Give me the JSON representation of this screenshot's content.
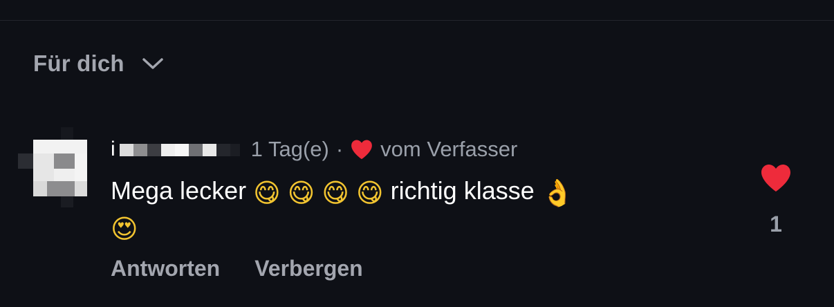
{
  "header": {
    "sort_label": "Für dich",
    "sort_icon": "chevron-down-icon"
  },
  "comment": {
    "username_initial": "i",
    "age": "1 Tag(e)",
    "separator": "·",
    "author_like_label": "vom Verfasser",
    "author_like_icon": "heart-icon",
    "text_start": "Mega lecker",
    "emoji_yum": "😋",
    "text_mid": "richtig klasse",
    "emoji_ok": "👌",
    "emoji_love": "😍",
    "like_count": "1",
    "like_icon": "heart-icon",
    "actions": {
      "reply": "Antworten",
      "hide": "Verbergen"
    }
  },
  "colors": {
    "background": "#0e1016",
    "heart": "#ee2b3b",
    "muted_text": "#9aa0aa",
    "primary_text": "#ffffff"
  }
}
